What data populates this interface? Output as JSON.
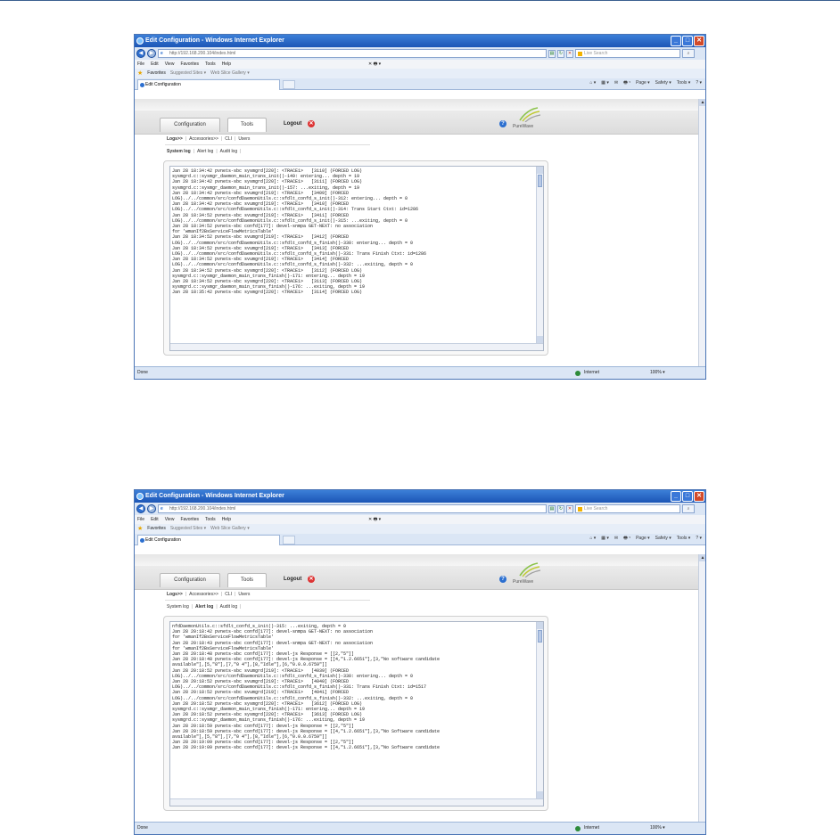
{
  "windows": [
    {
      "title": "Edit Configuration - Windows Internet Explorer",
      "address": "http://192.168.200.104/index.html",
      "search_placeholder": "Live Search",
      "menu": [
        "File",
        "Edit",
        "View",
        "Favorites",
        "Tools",
        "Help"
      ],
      "menu_extra": "✕  🖶 ▾",
      "favorites": {
        "label": "Favorites",
        "suggested": "Suggested Sites ▾",
        "webslice": "Web Slice Gallery ▾"
      },
      "tab_title": "Edit Configuration",
      "cmdbar": [
        "Page ▾",
        "Safety ▾",
        "Tools ▾",
        "? ▾"
      ],
      "app_tabs": {
        "configuration": "Configuration",
        "tools": "Tools"
      },
      "logout": "Logout",
      "logo_text": "PureWave",
      "subnav": [
        "Logs>>",
        "Accessories>>",
        "CLI",
        "Users"
      ],
      "subnav2": [
        "System log",
        "Alert log",
        "Audit log"
      ],
      "active_log": 0,
      "log_text": "Jan 28 18:34:42 pvnets-sbc sysmgrd[220]: <TRACE1>   [3110] (FORCED LOG)\nsysmgrd.c::sysmgr_daemon_main_trans_init()-149: entering... depth = 19\nJan 28 18:34:42 pvnets-sbc sysmgrd[220]: <TRACE1>   [3111] (FORCED LOG)\nsysmgrd.c::sysmgr_daemon_main_trans_init()-157: ...exiting, depth = 19\nJan 28 18:34:42 pvnets-sbc svumgrd[219]: <TRACE1>   [3409] (FORCED\nLOG)../../common/src/confdDaemonUtils.c::sfdlt_confd_s_init()-312: entering... depth = 0\nJan 28 18:34:42 pvnets-sbc svumgrd[219]: <TRACE1>   [3410] (FORCED\nLOG)../../common/src/confdDaemonUtils.c::sfdlt_confd_s_init()-314: Trans Start Ctxt: id=1286\nJan 28 18:34:52 pvnets-sbc svumgrd[219]: <TRACE1>   [3411] (FORCED\nLOG)../../common/src/confdDaemonUtils.c::sfdlt_confd_s_init()-315: ...exiting, depth = 0\nJan 28 18:34:52 pvnets-sbc confd[177]: devel-snmpa GET-NEXT: no association\nfor 'wmanIf2BsServiceFlowMetricsTable'\nJan 28 18:34:52 pvnets-sbc svumgrd[219]: <TRACE1>   [3412] (FORCED\nLOG)../../common/src/confdDaemonUtils.c::sfdlt_confd_s_finish()-330: entering... depth = 0\nJan 28 18:34:52 pvnets-sbc svumgrd[219]: <TRACE1>   [3413] (FORCED\nLOG)../../common/src/confdDaemonUtils.c::sfdlt_confd_s_finish()-331: Trans Finish Ctxt: id=1286\nJan 28 18:34:52 pvnets-sbc svumgrd[219]: <TRACE1>   [3414] (FORCED\nLOG)../../common/src/confdDaemonUtils.c::sfdlt_confd_s_finish()-332: ...exiting, depth = 0\nJan 28 18:34:52 pvnets-sbc sysmgrd[220]: <TRACE1>   [3112] (FORCED LOG)\nsysmgrd.c::sysmgr_daemon_main_trans_finish()-171: entering... depth = 19\nJan 28 18:34:52 pvnets-sbc sysmgrd[220]: <TRACE1>   [3113] (FORCED LOG)\nsysmgrd.c::sysmgr_daemon_main_trans_finish()-176: ...exiting, depth = 19\nJan 28 18:35:42 pvnets-sbc sysmgrd[220]: <TRACE1>   [3114] (FORCED LOG)",
      "status_done": "Done",
      "status_zone": "Internet",
      "status_zoom": "100% ▾"
    },
    {
      "title": "Edit Configuration - Windows Internet Explorer",
      "address": "http://192.168.200.104/index.html",
      "search_placeholder": "Live Search",
      "menu": [
        "File",
        "Edit",
        "View",
        "Favorites",
        "Tools",
        "Help"
      ],
      "menu_extra": "✕  🖶 ▾",
      "favorites": {
        "label": "Favorites",
        "suggested": "Suggested Sites ▾",
        "webslice": "Web Slice Gallery ▾"
      },
      "tab_title": "Edit Configuration",
      "cmdbar": [
        "Page ▾",
        "Safety ▾",
        "Tools ▾",
        "? ▾"
      ],
      "app_tabs": {
        "configuration": "Configuration",
        "tools": "Tools"
      },
      "logout": "Logout",
      "logo_text": "PureWave",
      "subnav": [
        "Logs>>",
        "Accessories>>",
        "CLI",
        "Users"
      ],
      "subnav2": [
        "System log",
        "Alert log",
        "Audit log"
      ],
      "active_log": 1,
      "log_text": "nfdDaemonUtils.c::sfdlt_confd_s_init()-315: ...exiting, depth = 0\nJan 28 20:18:42 pvnets-sbc confd[177]: devel-snmpa GET-NEXT: no association\nfor 'wmanIf2BsServiceFlowMetricsTable'\nJan 28 20:18:43 pvnets-sbc confd[177]: devel-snmpa GET-NEXT: no association\nfor 'wmanIf2BsServiceFlowMetricsTable'\nJan 28 20:18:48 pvnets-sbc confd[177]: devel-js Response = [[2,\"5\"]]\nJan 28 20:18:48 pvnets-sbc confd[177]: devel-js Response = [[4,\"1.2.6651\"],[3,\"No software candidate\navailable\"],[5,\"8\"],[7,\"0 4\"],[8,\"Idle\"],[6,\"0.0.0.6759\"]]\nJan 28 20:18:52 pvnets-sbc svumgrd[219]: <TRACE1>   [4039] (FORCED\nLOG)../../common/src/confdDaemonUtils.c::sfdlt_confd_s_finish()-330: entering... depth = 0\nJan 28 20:18:52 pvnets-sbc svumgrd[219]: <TRACE1>   [4040] (FORCED\nLOG)../../common/src/confdDaemonUtils.c::sfdlt_confd_s_finish()-331: Trans Finish Ctxt: id=1517\nJan 28 20:18:52 pvnets-sbc svumgrd[219]: <TRACE1>   [4041] (FORCED\nLOG)../../common/src/confdDaemonUtils.c::sfdlt_confd_s_finish()-332: ...exiting, depth = 0\nJan 28 20:18:52 pvnets-sbc sysmgrd[220]: <TRACE1>   [3612] (FORCED LOG)\nsysmgrd.c::sysmgr_daemon_main_trans_finish()-171: entering... depth = 19\nJan 28 20:18:52 pvnets-sbc sysmgrd[220]: <TRACE1>   [3613] (FORCED LOG)\nsysmgrd.c::sysmgr_daemon_main_trans_finish()-176: ...exiting, depth = 19\nJan 28 20:18:59 pvnets-sbc confd[177]: devel-js Response = [[2,\"5\"]]\nJan 28 20:18:59 pvnets-sbc confd[177]: devel-js Response = [[4,\"1.2.6651\"],[3,\"No Software candidate\navailable\"],[5,\"8\"],[7,\"0 4\"],[8,\"Idle\"],[6,\"0.0.0.6759\"]]\nJan 28 20:19:09 pvnets-sbc confd[177]: devel-js Response = [[2,\"5\"]]\nJan 28 20:19:09 pvnets-sbc confd[177]: devel-js Response = [[4,\"1.2.6651\"],[3,\"No Software candidate",
      "status_done": "Done",
      "status_zone": "Internet",
      "status_zoom": "100% ▾"
    }
  ]
}
